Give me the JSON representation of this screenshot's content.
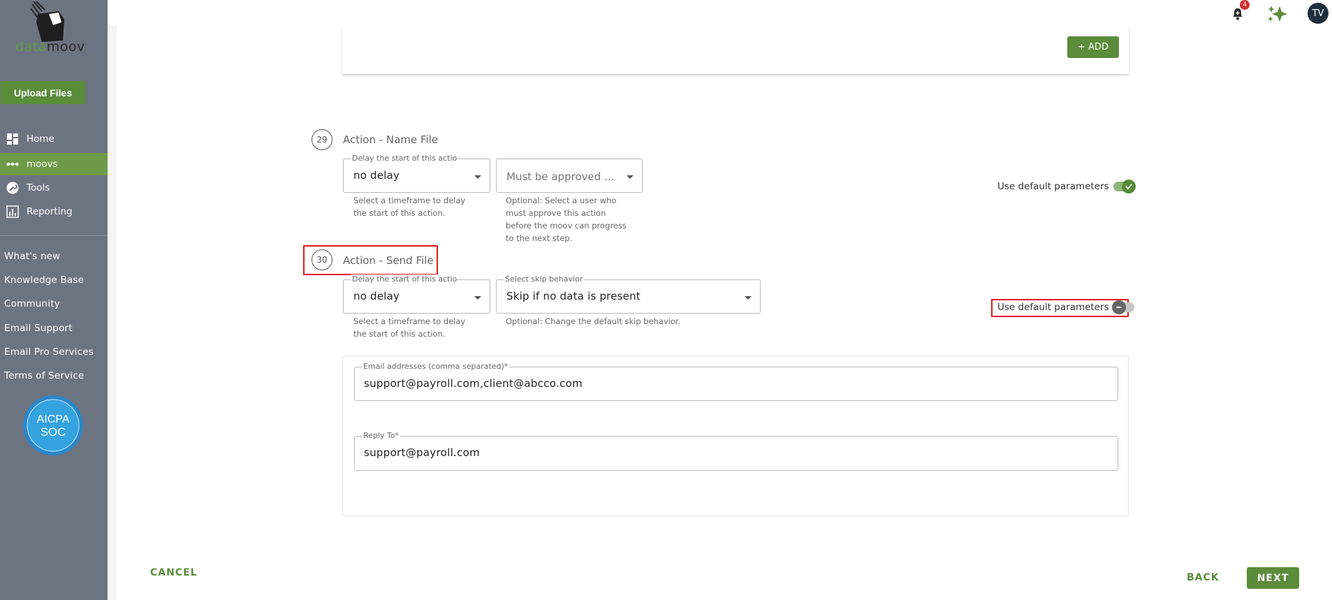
{
  "app": {
    "logo_part1": "data",
    "logo_part2": "moov"
  },
  "sidebar": {
    "upload_label": "Upload Files",
    "nav": [
      {
        "label": "Home",
        "icon": "dashboard-icon"
      },
      {
        "label": "moovs",
        "icon": "moovs-dots-icon",
        "active": true
      },
      {
        "label": "Tools",
        "icon": "wrench-icon"
      },
      {
        "label": "Reporting",
        "icon": "bar-chart-icon"
      }
    ],
    "links": [
      "What's new",
      "Knowledge Base",
      "Community",
      "Email Support",
      "Email Pro Services",
      "Terms of Service"
    ],
    "badge_title": "AICPA",
    "badge_sub": "SOC"
  },
  "topbar": {
    "notification_count": "4",
    "avatar_initials": "TV"
  },
  "prev_card": {
    "add_label": "+ ADD"
  },
  "step29": {
    "number": "29",
    "title": "Action - Name File",
    "delay_label": "Delay the start of this actio",
    "delay_value": "no delay",
    "delay_helper": "Select a timeframe to delay the start of this action.",
    "approver_placeholder": "Must be approved ...",
    "approver_helper": "Optional: Select a user who must approve this action before the moov can progress to the next step.",
    "default_params_label": "Use default parameters",
    "default_params_on": true
  },
  "step30": {
    "number": "30",
    "title": "Action - Send File",
    "delay_label": "Delay the start of this actio",
    "delay_value": "no delay",
    "delay_helper": "Select a timeframe to delay the start of this action.",
    "skip_label": "Select skip behavior",
    "skip_value": "Skip if no data is present",
    "skip_helper": "Optional: Change the default skip behavior.",
    "default_params_label": "Use default parameters",
    "default_params_on": false,
    "email_label": "Email addresses (comma separated)*",
    "email_value": "support@payroll.com,client@abcco.com",
    "reply_label": "Reply To*",
    "reply_value": "support@payroll.com"
  },
  "footer": {
    "cancel_label": "CANCEL",
    "back_label": "BACK",
    "next_label": "NEXT"
  },
  "colors": {
    "brand_green": "#5b8c3a",
    "sidebar_bg": "#6d7481",
    "highlight_red": "#e01b1b"
  }
}
